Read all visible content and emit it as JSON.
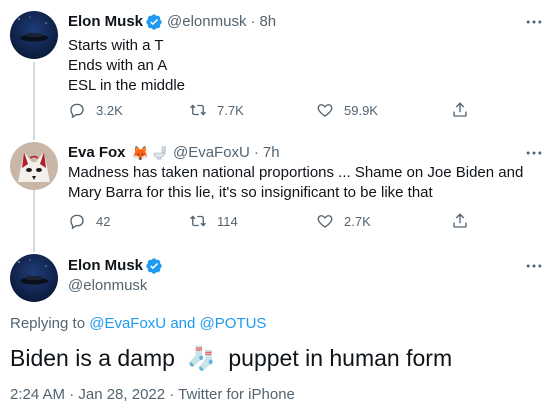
{
  "tweet1": {
    "name": "Elon Musk",
    "handle": "@elonmusk",
    "separator": "·",
    "time": "8h",
    "lines": [
      "Starts with a T",
      "Ends with an A",
      "ESL in the middle"
    ],
    "reply_count": "3.2K",
    "retweet_count": "7.7K",
    "like_count": "59.9K"
  },
  "tweet2": {
    "name": "Eva Fox",
    "name_emoji": "🦊",
    "handle": "@EvaFoxU",
    "separator": "·",
    "time": "7h",
    "text": "Madness has taken national proportions ... Shame on Joe Biden and Mary Barra for this lie, it's so insignificant to be like that",
    "reply_count": "42",
    "retweet_count": "114",
    "like_count": "2.7K"
  },
  "main": {
    "name": "Elon Musk",
    "handle": "@elonmusk",
    "replying_prefix": "Replying to",
    "replying_user1": "@EvaFoxU",
    "replying_and": "and",
    "replying_user2": "@POTUS",
    "text_before": "Biden is a damp",
    "emoji": "🧦",
    "text_after": "puppet in human form",
    "timestamp": "2:24 AM · Jan 28, 2022 · ",
    "source": "Twitter for iPhone"
  },
  "colors": {
    "accent": "#1d9bf0",
    "muted": "#536471",
    "text": "#0f1419"
  }
}
